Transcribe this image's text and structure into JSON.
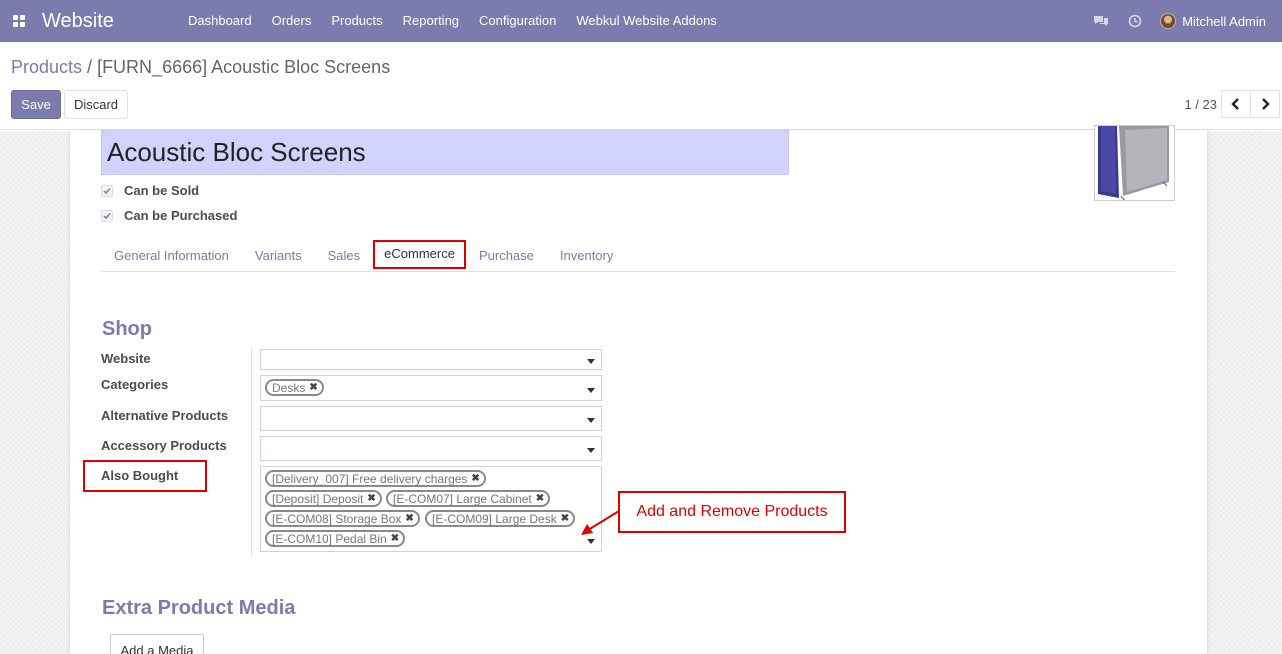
{
  "navbar": {
    "brand": "Website",
    "menu": [
      "Dashboard",
      "Orders",
      "Products",
      "Reporting",
      "Configuration",
      "Webkul Website Addons"
    ],
    "user_name": "Mitchell Admin"
  },
  "breadcrumb": {
    "parent": "Products",
    "separator": " / ",
    "current": "[FURN_6666] Acoustic Bloc Screens"
  },
  "buttons": {
    "save": "Save",
    "discard": "Discard",
    "add_media": "Add a Media"
  },
  "pager": {
    "value": "1 / 23"
  },
  "product": {
    "name": "Acoustic Bloc Screens",
    "can_be_sold": "Can be Sold",
    "can_be_purchased": "Can be Purchased"
  },
  "tabs": [
    {
      "label": "General Information",
      "active": false
    },
    {
      "label": "Variants",
      "active": false
    },
    {
      "label": "Sales",
      "active": false
    },
    {
      "label": "eCommerce",
      "active": true
    },
    {
      "label": "Purchase",
      "active": false
    },
    {
      "label": "Inventory",
      "active": false
    }
  ],
  "shop": {
    "title": "Shop",
    "website_label": "Website",
    "categories_label": "Categories",
    "categories_tags": [
      "Desks"
    ],
    "alternative_label": "Alternative Products",
    "accessory_label": "Accessory Products",
    "also_bought_label": "Also Bought",
    "also_bought_tags": [
      "[Delivery_007] Free delivery charges",
      "[Deposit] Deposit",
      "[E-COM07] Large Cabinet",
      "[E-COM08] Storage Box",
      "[E-COM09] Large Desk",
      "[E-COM10] Pedal Bin"
    ]
  },
  "annotation": {
    "text": "Add and Remove Products"
  },
  "extra_media": {
    "title": "Extra Product Media"
  },
  "colors": {
    "brand": "#7c7bad",
    "highlight_red": "#e00000",
    "title_field_bg": "#d2d2ff"
  }
}
